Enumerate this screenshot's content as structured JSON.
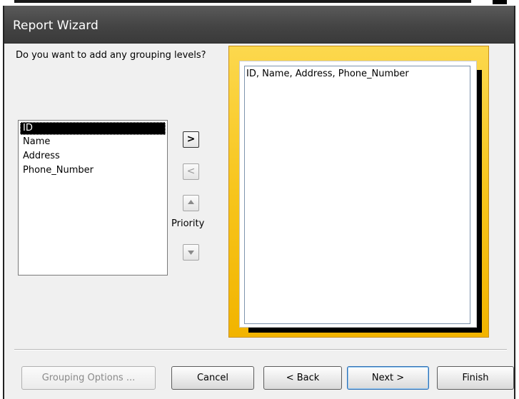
{
  "window": {
    "title": "Report Wizard"
  },
  "prompt": "Do you want to add any grouping levels?",
  "field_list": {
    "items": [
      "ID",
      "Name",
      "Address",
      "Phone_Number"
    ],
    "selected": "ID"
  },
  "controls": {
    "add_label": ">",
    "remove_label": "<",
    "priority_up_icon": "up-arrow-icon",
    "priority_down_icon": "down-arrow-icon",
    "priority_label": "Priority"
  },
  "preview": {
    "fields_text": "ID, Name, Address, Phone_Number"
  },
  "buttons": {
    "grouping_options": "Grouping Options ...",
    "cancel": "Cancel",
    "back": "< Back",
    "next": "Next >",
    "finish": "Finish"
  },
  "colors": {
    "titlebar": "#444444",
    "preview_frame": "#f7c51c",
    "preview_border": "#7e94ad"
  }
}
